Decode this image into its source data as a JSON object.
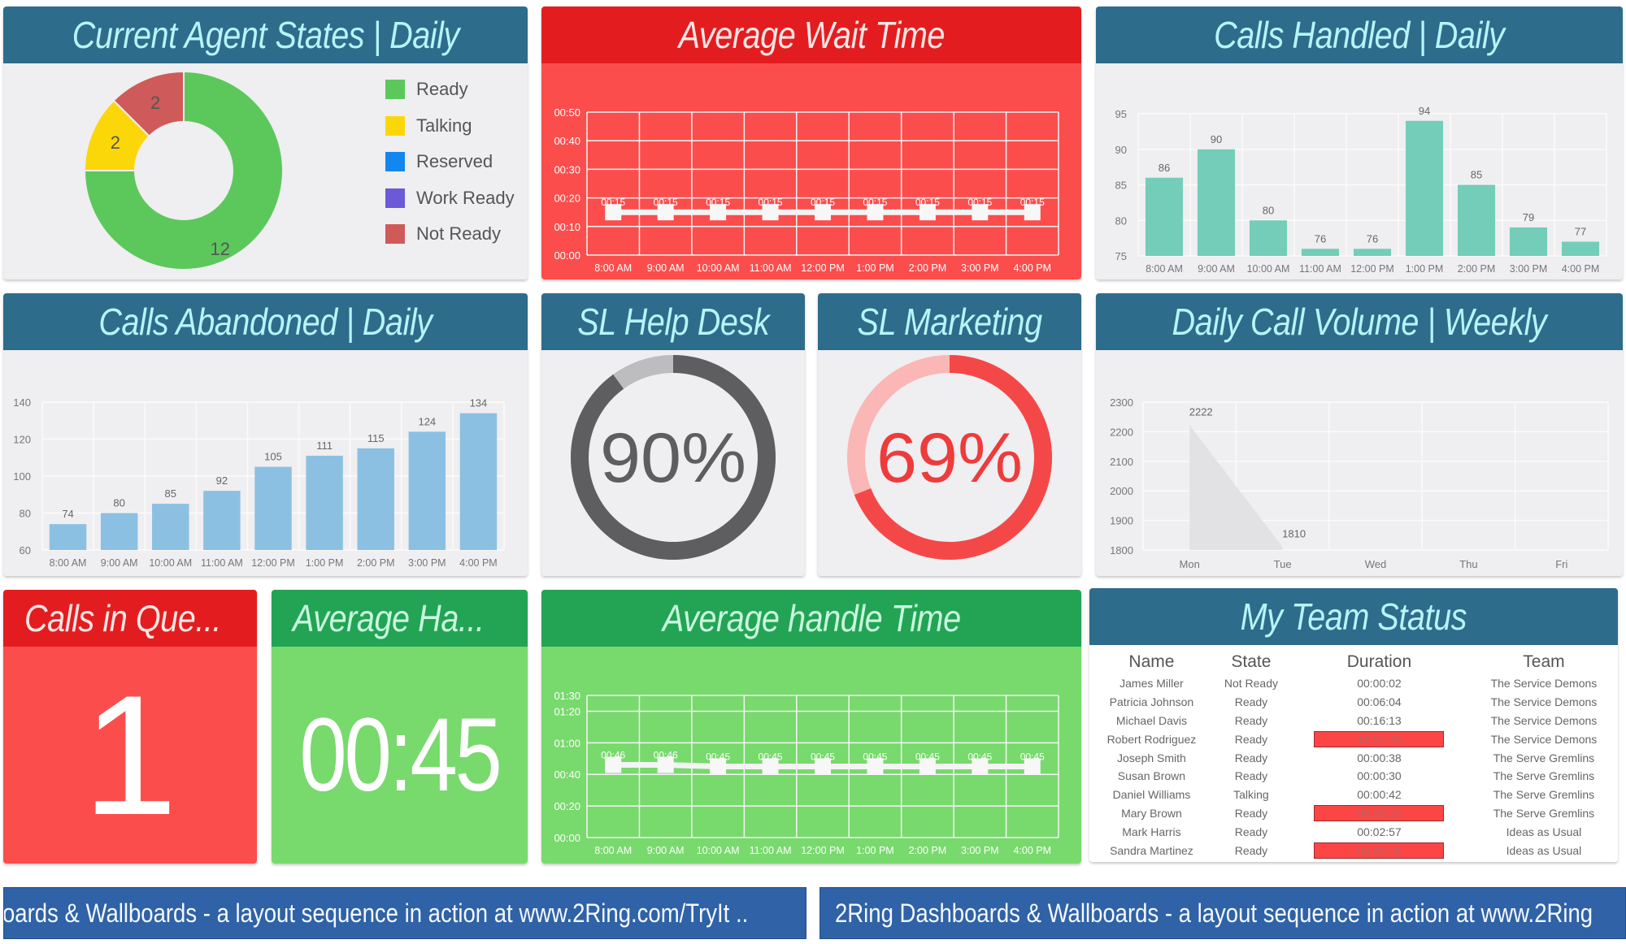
{
  "colors": {
    "header_blue": "#2e6c8c",
    "header_red": "#e31d1f",
    "header_green": "#23a454",
    "body_red": "#fc4d4d",
    "body_green": "#78d96d",
    "banner_blue": "#2f62a6"
  },
  "agent_states": {
    "title": "Current Agent States | Daily",
    "chart_data": {
      "type": "pie",
      "title": "Current Agent States | Daily",
      "donut": true,
      "legend_position": "right",
      "slices": [
        {
          "label": "Ready",
          "value": 12,
          "color": "#5cc85c"
        },
        {
          "label": "Talking",
          "value": 2,
          "color": "#fbd70a"
        },
        {
          "label": "Reserved",
          "value": 0,
          "color": "#1387f0"
        },
        {
          "label": "Work Ready",
          "value": 0,
          "color": "#6a5ad8"
        },
        {
          "label": "Not Ready",
          "value": 2,
          "color": "#cf5a5a"
        }
      ]
    }
  },
  "avg_wait_time": {
    "title": "Average Wait Time",
    "chart_data": {
      "type": "line",
      "title": "Average Wait Time",
      "categories": [
        "8:00 AM",
        "9:00 AM",
        "10:00 AM",
        "11:00 AM",
        "12:00 PM",
        "1:00 PM",
        "2:00 PM",
        "3:00 PM",
        "4:00 PM"
      ],
      "values_seconds": [
        15,
        15,
        15,
        15,
        15,
        15,
        15,
        15,
        15
      ],
      "data_labels": [
        "00:15",
        "00:15",
        "00:15",
        "00:15",
        "00:15",
        "00:15",
        "00:15",
        "00:15",
        "00:15"
      ],
      "y_ticks": [
        "00:00",
        "00:10",
        "00:20",
        "00:30",
        "00:40",
        "00:50"
      ],
      "y_tick_values": [
        0,
        10,
        20,
        30,
        40,
        50
      ],
      "ylim": [
        0,
        50
      ],
      "grid": true
    }
  },
  "calls_handled": {
    "title": "Calls Handled | Daily",
    "chart_data": {
      "type": "bar",
      "title": "Calls Handled | Daily",
      "categories": [
        "8:00 AM",
        "9:00 AM",
        "10:00 AM",
        "11:00 AM",
        "12:00 PM",
        "1:00 PM",
        "2:00 PM",
        "3:00 PM",
        "4:00 PM"
      ],
      "values": [
        86,
        90,
        80,
        76,
        76,
        94,
        85,
        79,
        77
      ],
      "y_ticks": [
        75,
        80,
        85,
        90,
        95
      ],
      "ylim": [
        75,
        95
      ],
      "bar_color": "#74cdb8",
      "grid": true
    }
  },
  "calls_abandoned": {
    "title": "Calls Abandoned | Daily",
    "chart_data": {
      "type": "bar",
      "title": "Calls Abandoned | Daily",
      "categories": [
        "8:00 AM",
        "9:00 AM",
        "10:00 AM",
        "11:00 AM",
        "12:00 PM",
        "1:00 PM",
        "2:00 PM",
        "3:00 PM",
        "4:00 PM"
      ],
      "values": [
        74,
        80,
        85,
        92,
        105,
        111,
        115,
        124,
        134
      ],
      "y_ticks": [
        60,
        80,
        100,
        120,
        140
      ],
      "ylim": [
        60,
        140
      ],
      "bar_color": "#8cc0e2",
      "grid": true
    }
  },
  "sl_help_desk": {
    "title": "SL Help Desk",
    "value_label": "90%",
    "percent": 90,
    "fill_color": "#5e5d60",
    "track_color": "#bdbcbe",
    "text_color": "#5e5d60"
  },
  "sl_marketing": {
    "title": "SL Marketing",
    "value_label": "69%",
    "percent": 69,
    "fill_color": "#f44848",
    "track_color": "#fbb6b6",
    "text_color": "#ee3b3b"
  },
  "daily_call_volume": {
    "title": "Daily Call Volume | Weekly",
    "chart_data": {
      "type": "area",
      "title": "Daily Call Volume | Weekly",
      "categories": [
        "Mon",
        "Tue",
        "Wed",
        "Thu",
        "Fri"
      ],
      "values": [
        2222,
        1810,
        null,
        null,
        null
      ],
      "y_ticks": [
        1800,
        1900,
        2000,
        2100,
        2200,
        2300
      ],
      "ylim": [
        1800,
        2300
      ],
      "area_color": "#e2e1e3",
      "grid": true
    }
  },
  "calls_in_queue": {
    "title": "Calls in Que...",
    "value": "1"
  },
  "average_handle_tile": {
    "title": "Average Ha...",
    "value": "00:45"
  },
  "avg_handle_time": {
    "title": "Average handle Time",
    "chart_data": {
      "type": "line",
      "title": "Average handle Time",
      "categories": [
        "8:00 AM",
        "9:00 AM",
        "10:00 AM",
        "11:00 AM",
        "12:00 PM",
        "1:00 PM",
        "2:00 PM",
        "3:00 PM",
        "4:00 PM"
      ],
      "values_seconds": [
        46,
        46,
        45,
        45,
        45,
        45,
        45,
        45,
        45
      ],
      "data_labels": [
        "00:46",
        "00:46",
        "00:45",
        "00:45",
        "00:45",
        "00:45",
        "00:45",
        "00:45",
        "00:45"
      ],
      "y_ticks": [
        "00:00",
        "00:20",
        "00:40",
        "01:00",
        "01:20",
        "01:30"
      ],
      "y_tick_values": [
        0,
        20,
        40,
        60,
        80,
        90
      ],
      "ylim": [
        0,
        90
      ],
      "grid": true
    }
  },
  "team_status": {
    "title": "My Team Status",
    "columns": [
      "Name",
      "State",
      "Duration",
      "Team"
    ],
    "rows": [
      {
        "name": "James Miller",
        "state": "Not Ready",
        "duration": "00:00:02",
        "team": "The Service Demons",
        "alert": false
      },
      {
        "name": "Patricia Johnson",
        "state": "Ready",
        "duration": "00:06:04",
        "team": "The Service Demons",
        "alert": false
      },
      {
        "name": "Michael Davis",
        "state": "Ready",
        "duration": "00:16:13",
        "team": "The Service Demons",
        "alert": false
      },
      {
        "name": "Robert Rodriguez",
        "state": "Ready",
        "duration": "16:57:45",
        "team": "The Service Demons",
        "alert": true
      },
      {
        "name": "Joseph Smith",
        "state": "Ready",
        "duration": "00:00:38",
        "team": "The Serve Gremlins",
        "alert": false
      },
      {
        "name": "Susan Brown",
        "state": "Ready",
        "duration": "00:00:30",
        "team": "The Serve Gremlins",
        "alert": false
      },
      {
        "name": "Daniel Williams",
        "state": "Talking",
        "duration": "00:00:42",
        "team": "The Serve Gremlins",
        "alert": false
      },
      {
        "name": "Mary Brown",
        "state": "Ready",
        "duration": "00:26:39",
        "team": "The Serve Gremlins",
        "alert": true
      },
      {
        "name": "Mark Harris",
        "state": "Ready",
        "duration": "00:02:57",
        "team": "Ideas as Usual",
        "alert": false
      },
      {
        "name": "Sandra Martinez",
        "state": "Ready",
        "duration": "00:48:06",
        "team": "Ideas as Usual",
        "alert": true
      }
    ]
  },
  "ticker": {
    "left_text": "oards & Wallboards - a layout sequence in action at www.2Ring.com/TryIt ..",
    "right_text": "2Ring Dashboards & Wallboards - a layout sequence in action at www.2Ring"
  }
}
